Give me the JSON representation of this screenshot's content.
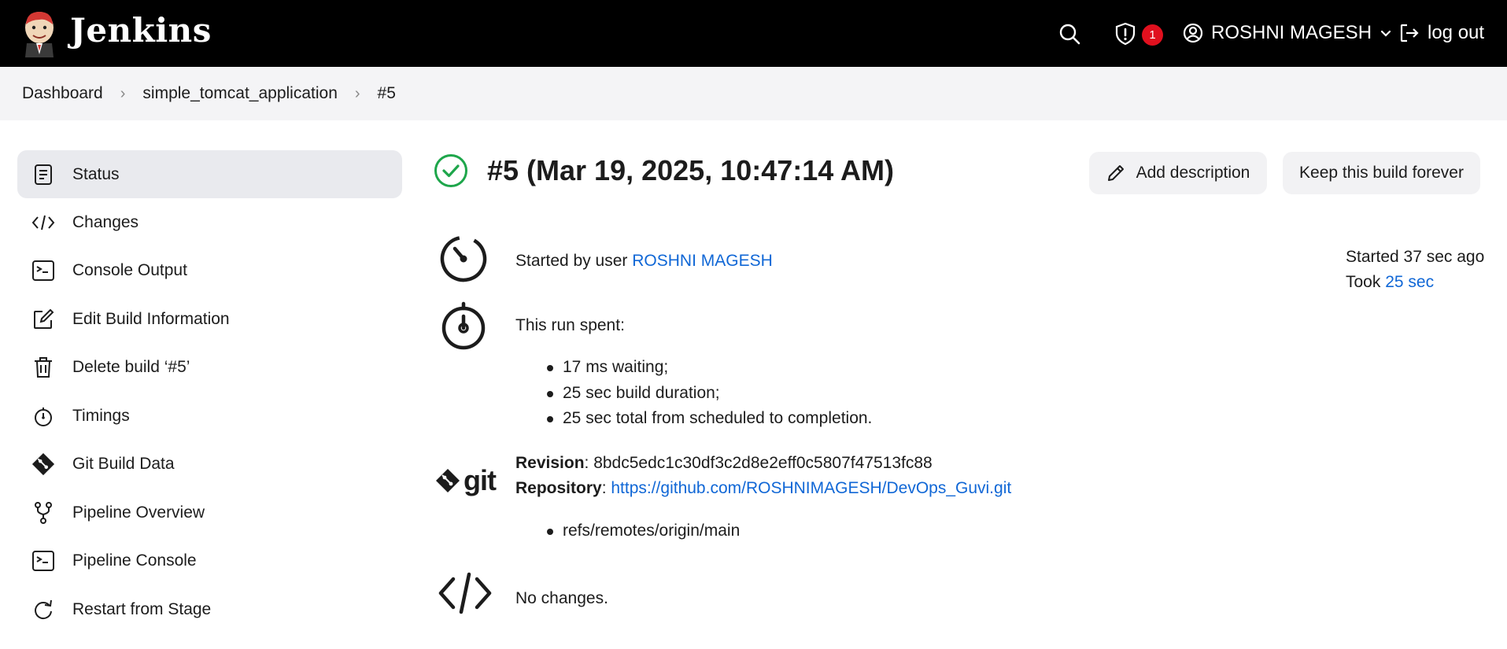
{
  "header": {
    "brand": "Jenkins",
    "notification_count": "1",
    "user_name": "ROSHNI MAGESH",
    "logout_label": "log out"
  },
  "breadcrumbs": [
    "Dashboard",
    "simple_tomcat_application",
    "#5"
  ],
  "sidebar": {
    "items": [
      {
        "label": "Status",
        "icon": "document-icon"
      },
      {
        "label": "Changes",
        "icon": "code-icon"
      },
      {
        "label": "Console Output",
        "icon": "terminal-icon"
      },
      {
        "label": "Edit Build Information",
        "icon": "edit-icon"
      },
      {
        "label": "Delete build ‘#5’",
        "icon": "trash-icon"
      },
      {
        "label": "Timings",
        "icon": "stopwatch-icon"
      },
      {
        "label": "Git Build Data",
        "icon": "git-icon"
      },
      {
        "label": "Pipeline Overview",
        "icon": "fork-icon"
      },
      {
        "label": "Pipeline Console",
        "icon": "terminal-icon"
      },
      {
        "label": "Restart from Stage",
        "icon": "restart-icon"
      }
    ]
  },
  "build": {
    "title": "#5 (Mar 19, 2025, 10:47:14 AM)",
    "status": "success",
    "add_description_label": "Add description",
    "keep_forever_label": "Keep this build forever",
    "started_by_prefix": "Started by user ",
    "started_by_user": "ROSHNI MAGESH",
    "started_ago": "Started 37 sec ago",
    "took_prefix": "Took ",
    "took_value": "25 sec",
    "run_spent_label": "This run spent:",
    "run_spent_items": [
      "17 ms waiting;",
      "25 sec build duration;",
      "25 sec total from scheduled to completion."
    ],
    "git_logo_text": "git",
    "revision_label": "Revision",
    "revision_value": ": 8bdc5edc1c30df3c2d8e2eff0c5807f47513fc88",
    "repository_label": "Repository",
    "repository_sep": ": ",
    "repository_url": "https://github.com/ROSHNIMAGESH/DevOps_Guvi.git",
    "refs": [
      "refs/remotes/origin/main"
    ],
    "changes_text": "No changes."
  },
  "colors": {
    "header_bg": "#000000",
    "breadcrumb_bg": "#f4f4f6",
    "link": "#1067d6",
    "success": "#1ea64b",
    "badge": "#e0101e"
  }
}
